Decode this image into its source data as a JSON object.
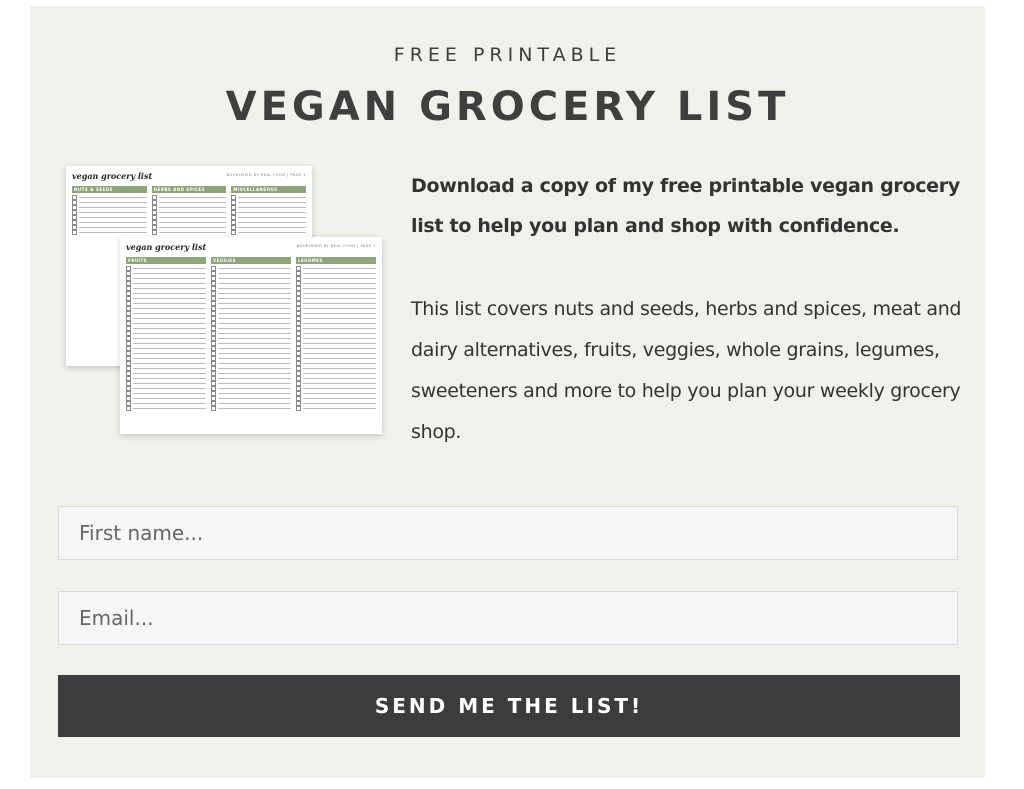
{
  "header": {
    "kicker": "FREE PRINTABLE",
    "title": "VEGAN GROCERY LIST"
  },
  "preview": {
    "sheet_title": "vegan grocery list",
    "brand": "NOURISHED BY REAL FOOD | PAGE 1",
    "back_sections": [
      "NUTS & SEEDS",
      "HERBS AND SPICES",
      "MISCELLANEOUS"
    ],
    "front_sections": [
      "FRUITS",
      "VEGGIES",
      "LEGUMES"
    ],
    "band_color": "#8ea57a"
  },
  "content": {
    "lead": "Download a copy of my free printable vegan grocery list to help you plan and shop with confidence.",
    "body": "This list covers nuts and seeds, herbs and spices, meat and dairy alternatives, fruits, veggies, whole grains, legumes, sweeteners and more to help you plan your weekly grocery shop."
  },
  "form": {
    "name_placeholder": "First name...",
    "email_placeholder": "Email...",
    "submit_label": "SEND ME THE LIST!"
  },
  "colors": {
    "card_bg": "#eef2ea",
    "button_bg": "#3c3c3c"
  }
}
